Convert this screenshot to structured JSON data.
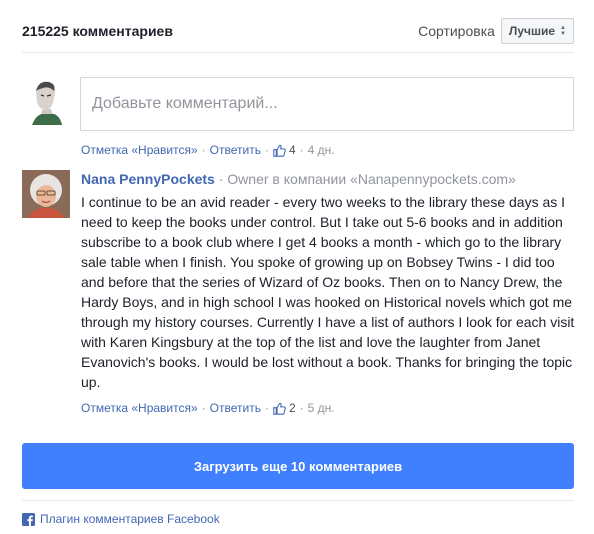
{
  "header": {
    "count_label": "215225 комментариев",
    "sort_label": "Сортировка",
    "sort_value": "Лучшие"
  },
  "composer": {
    "placeholder": "Добавьте комментарий..."
  },
  "first_meta": {
    "like_action": "Отметка «Нравится»",
    "reply_action": "Ответить",
    "likes": "4",
    "time": "4 дн."
  },
  "comment": {
    "author": "Nana PennyPockets",
    "role": "Owner в компании «Nanapennypockets.com»",
    "text": "I continue to be an avid reader - every two weeks to the library these days as I need to keep the books under control. But I take out 5-6 books and in addition subscribe to a book club where I get 4 books a month - which go to the library sale table when I finish. You spoke of growing up on Bobsey Twins - I did too and before that the series of Wizard of Oz books. Then on to Nancy Drew, the Hardy Boys, and in high school I was hooked on Historical novels which got me through my history courses. Currently I have a list of authors I look for each visit with Karen Kingsbury at the top of the list and love the laughter from Janet Evanovich's books. I would be lost without a book. Thanks for bringing the topic up.",
    "like_action": "Отметка «Нравится»",
    "reply_action": "Ответить",
    "likes": "2",
    "time": "5 дн."
  },
  "load_more": {
    "label": "Загрузить еще 10 комментариев"
  },
  "footer": {
    "plugin_label": "Плагин комментариев Facebook"
  },
  "colors": {
    "link": "#4267b2",
    "button": "#4080ff",
    "meta": "#90949c"
  }
}
